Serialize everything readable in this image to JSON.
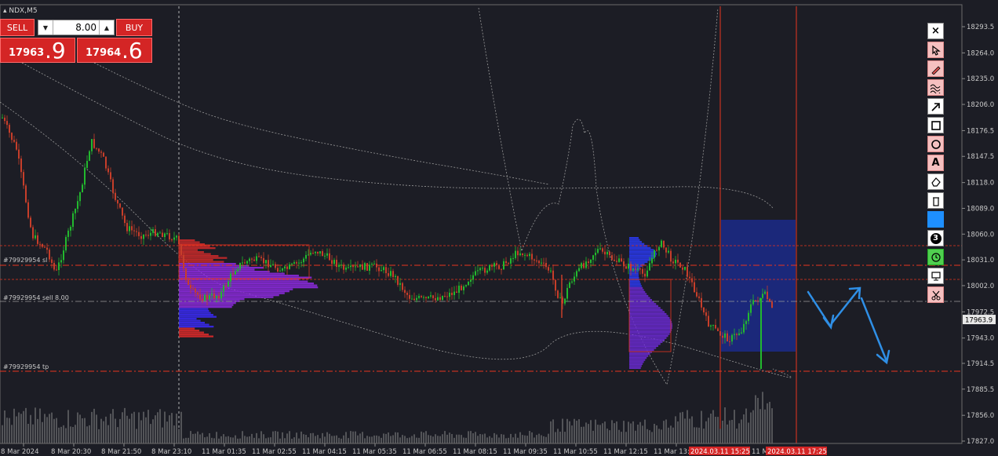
{
  "symbol": "NDX,M5",
  "trade_panel": {
    "sell_label": "SELL",
    "buy_label": "BUY",
    "lot": "8.00",
    "bid_small": "17963",
    "bid_big": ".9",
    "ask_small": "17964",
    "ask_big": ".6"
  },
  "order_lines": {
    "sl": "#79929954 sl",
    "sell": "#79929954 sell 8.00",
    "tp": "#79929954 tp"
  },
  "price_axis": {
    "labels": [
      "18293.5",
      "18264.0",
      "18235.0",
      "18206.0",
      "18176.5",
      "18147.5",
      "18118.0",
      "18089.0",
      "18060.0",
      "18031.0",
      "18002.0",
      "17972.5",
      "17943.0",
      "17914.5",
      "17885.5",
      "17856.0",
      "17827.0"
    ],
    "current_price": "17963.9"
  },
  "time_axis": {
    "labels": [
      "8 Mar 2024",
      "8 Mar 20:30",
      "8 Mar 21:50",
      "8 Mar 23:10",
      "11 Mar 01:35",
      "11 Mar 02:55",
      "11 Mar 04:15",
      "11 Mar 05:35",
      "11 Mar 06:55",
      "11 Mar 08:15",
      "11 Mar 09:35",
      "11 Mar 10:55",
      "11 Mar 12:15",
      "11 Mar 13:35"
    ],
    "partial_label": "11 M",
    "marker_1": "2024.03.11 15:25",
    "marker_2": "2024.03.11 17:25"
  },
  "toolbar": {
    "tools": [
      "close-tool",
      "cursor-tool",
      "pencil-tool",
      "wave-tool",
      "arrow-tool",
      "rectangle-tool",
      "ellipse-tool",
      "text-tool",
      "eraser-tool",
      "trash-tool",
      "color-tool",
      "number-tool",
      "timer-tool",
      "screenshot-tool",
      "scissors-tool"
    ],
    "close_glyph": "×",
    "text_glyph": "A",
    "number_glyph": "3"
  },
  "colors": {
    "background": "#1c1d25",
    "bull": "#22b92e",
    "bear": "#c73e2a",
    "level_line": "#e8351f",
    "drawing_arrow": "#2f8fe6",
    "zone": "#1b2a8a"
  }
}
